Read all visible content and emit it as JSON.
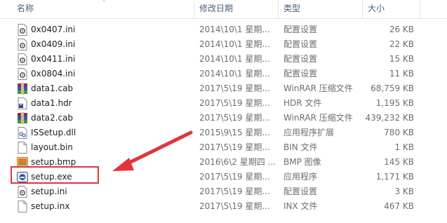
{
  "columns": {
    "name": "名称",
    "date": "修改日期",
    "type": "类型",
    "size": "大小"
  },
  "files": [
    {
      "name": "0x0407.ini",
      "date": "2014\\10\\1 星期...",
      "type": "配置设置",
      "size": "26 KB",
      "icon": "config-file-icon"
    },
    {
      "name": "0x0409.ini",
      "date": "2014\\10\\1 星期...",
      "type": "配置设置",
      "size": "22 KB",
      "icon": "config-file-icon"
    },
    {
      "name": "0x0411.ini",
      "date": "2014\\10\\1 星期...",
      "type": "配置设置",
      "size": "15 KB",
      "icon": "config-file-icon"
    },
    {
      "name": "0x0804.ini",
      "date": "2014\\10\\1 星期...",
      "type": "配置设置",
      "size": "11 KB",
      "icon": "config-file-icon"
    },
    {
      "name": "data1.cab",
      "date": "2017\\5\\19 星期...",
      "type": "WinRAR 压缩文件",
      "size": "68,759 KB",
      "icon": "winrar-archive-icon"
    },
    {
      "name": "data1.hdr",
      "date": "2017\\5\\19 星期...",
      "type": "HDR 文件",
      "size": "1,195 KB",
      "icon": "hdr-file-icon"
    },
    {
      "name": "data2.cab",
      "date": "2017\\5\\19 星期...",
      "type": "WinRAR 压缩文件",
      "size": "439,232 KB",
      "icon": "winrar-archive-icon"
    },
    {
      "name": "ISSetup.dll",
      "date": "2015\\9\\15 星期...",
      "type": "应用程序扩展",
      "size": "780 KB",
      "icon": "dll-file-icon"
    },
    {
      "name": "layout.bin",
      "date": "2017\\5\\19 星期...",
      "type": "BIN 文件",
      "size": "1 KB",
      "icon": "blank-file-icon"
    },
    {
      "name": "setup.bmp",
      "date": "2016\\6\\2 星期四 ...",
      "type": "BMP 图像",
      "size": "145 KB",
      "icon": "bmp-image-icon"
    },
    {
      "name": "setup.exe",
      "date": "2017\\5\\19 星期...",
      "type": "应用程序",
      "size": "1,171 KB",
      "icon": "setup-exe-icon"
    },
    {
      "name": "setup.ini",
      "date": "2017\\5\\19 星期...",
      "type": "配置设置",
      "size": "3 KB",
      "icon": "config-file-icon"
    },
    {
      "name": "setup.inx",
      "date": "2017\\5\\19 星期...",
      "type": "INX 文件",
      "size": "467 KB",
      "icon": "blank-file-icon"
    }
  ],
  "colors": {
    "highlight": "#e2343a",
    "header_text": "#4c607a"
  }
}
